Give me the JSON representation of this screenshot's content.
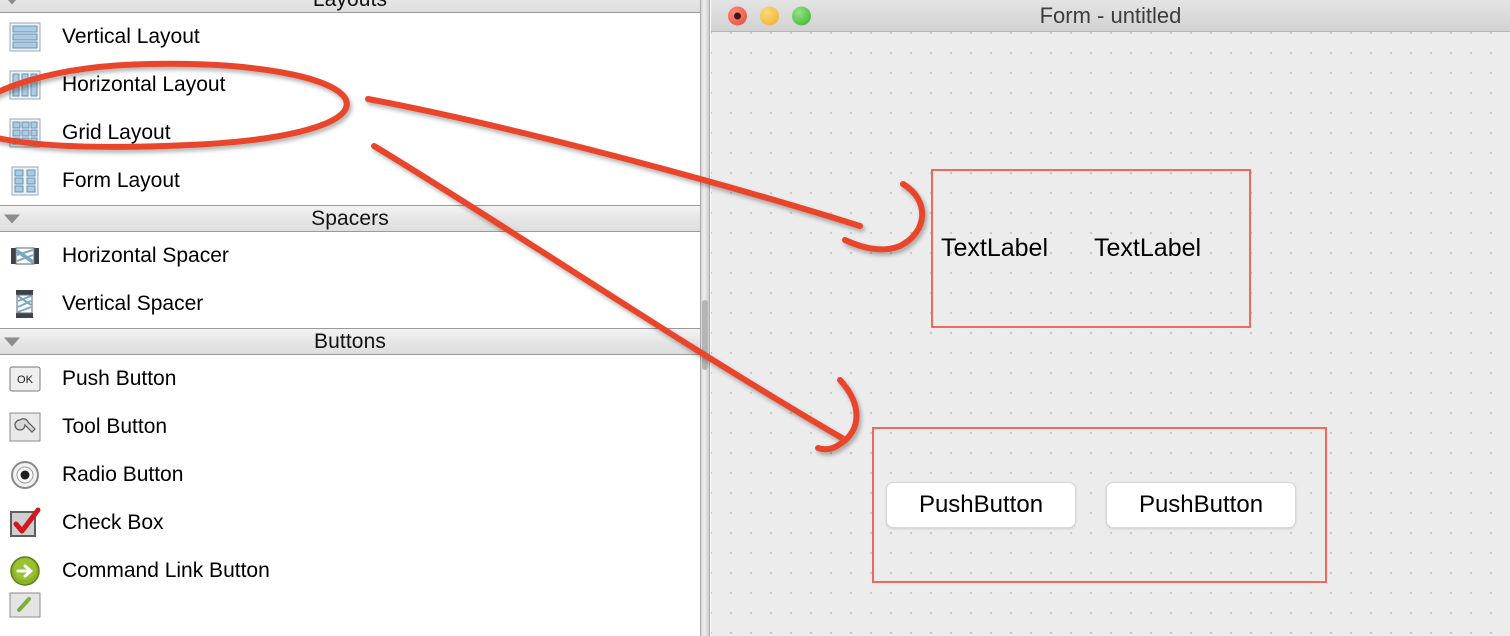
{
  "widget_box": {
    "sections": [
      {
        "title": "Layouts",
        "icon": "disclosure-triangle-icon",
        "items": [
          {
            "label": "Vertical Layout",
            "icon": "vertical-layout-icon"
          },
          {
            "label": "Horizontal Layout",
            "icon": "horizontal-layout-icon"
          },
          {
            "label": "Grid Layout",
            "icon": "grid-layout-icon"
          },
          {
            "label": "Form Layout",
            "icon": "form-layout-icon"
          }
        ]
      },
      {
        "title": "Spacers",
        "icon": "disclosure-triangle-icon",
        "items": [
          {
            "label": "Horizontal Spacer",
            "icon": "horizontal-spacer-icon"
          },
          {
            "label": "Vertical Spacer",
            "icon": "vertical-spacer-icon"
          }
        ]
      },
      {
        "title": "Buttons",
        "icon": "disclosure-triangle-icon",
        "items": [
          {
            "label": "Push Button",
            "icon": "push-button-icon"
          },
          {
            "label": "Tool Button",
            "icon": "tool-button-icon"
          },
          {
            "label": "Radio Button",
            "icon": "radio-button-icon"
          },
          {
            "label": "Check Box",
            "icon": "check-box-icon"
          },
          {
            "label": "Command Link Button",
            "icon": "command-link-button-icon"
          }
        ]
      }
    ]
  },
  "form_window": {
    "title": "Form - untitled",
    "traffic_lights": [
      {
        "name": "close",
        "color": "#ec5e4f"
      },
      {
        "name": "minimize",
        "color": "#f1bb40"
      },
      {
        "name": "zoom",
        "color": "#53c248"
      }
    ],
    "canvas": {
      "background_color": "#ececec",
      "grid_dot_color": "#c9c9c9",
      "layouts": [
        {
          "name": "horizontal-layout-labels",
          "border_color": "#ef6a5a",
          "children": [
            {
              "type": "label",
              "text": "TextLabel"
            },
            {
              "type": "label",
              "text": "TextLabel"
            }
          ]
        },
        {
          "name": "horizontal-layout-buttons",
          "border_color": "#ef6a5a",
          "children": [
            {
              "type": "button",
              "text": "PushButton"
            },
            {
              "type": "button",
              "text": "PushButton"
            }
          ]
        }
      ]
    }
  },
  "annotations": {
    "color": "#e8452c",
    "shapes": [
      {
        "name": "ellipse-highlight-horizontal-layout",
        "target": "Horizontal Layout"
      },
      {
        "name": "arrow-to-label-layout",
        "target": "TextLabel layout"
      },
      {
        "name": "arrow-to-button-layout",
        "target": "PushButton layout"
      }
    ]
  }
}
